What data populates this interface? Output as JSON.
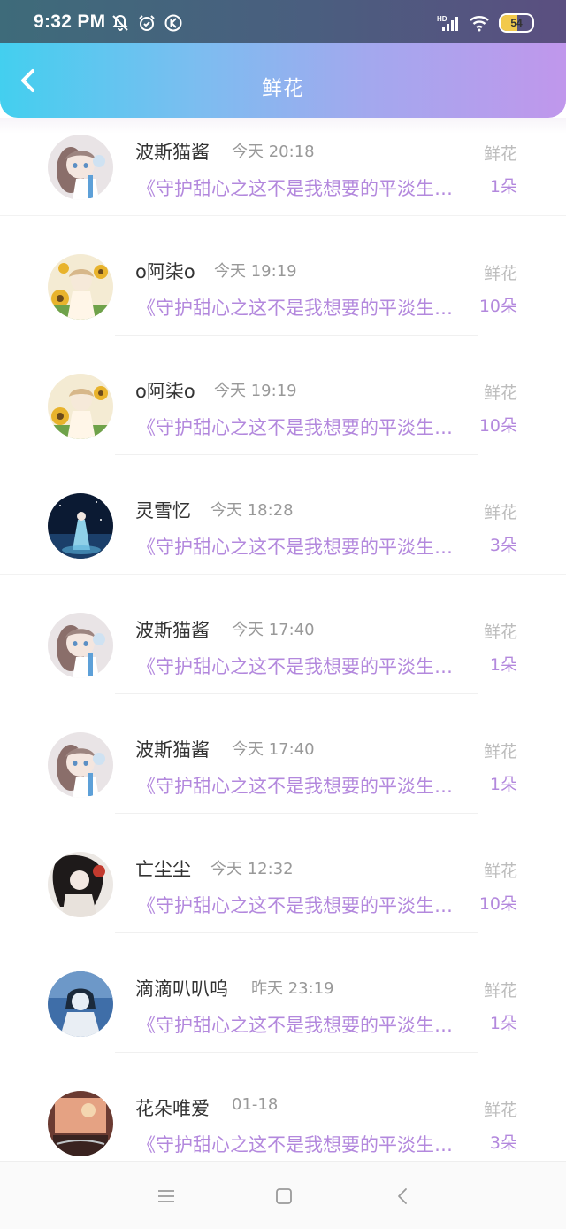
{
  "status_bar": {
    "time": "9:32 PM",
    "battery_level": "54",
    "icons": [
      "mute-icon",
      "alarm-icon",
      "k-icon",
      "hd-signal-icon",
      "wifi-icon",
      "battery-icon"
    ]
  },
  "header": {
    "title": "鲜花",
    "back_icon": "chevron-left-icon"
  },
  "colors": {
    "gradient_start": "#43cfef",
    "gradient_end": "#c097ec",
    "accent_purple": "#b388dd",
    "muted_gray": "#999999"
  },
  "items": [
    {
      "name": "波斯猫酱",
      "time": "今天 20:18",
      "book": "《守护甜心之这不是我想要的平淡生活》",
      "gift": "鲜花",
      "count": "1朵",
      "avatar": "avatar-catgirl"
    },
    {
      "name": "o阿柒o",
      "time": "今天 19:19",
      "book": "《守护甜心之这不是我想要的平淡生活》",
      "gift": "鲜花",
      "count": "10朵",
      "avatar": "avatar-sunflower"
    },
    {
      "name": "o阿柒o",
      "time": "今天 19:19",
      "book": "《守护甜心之这不是我想要的平淡生活》",
      "gift": "鲜花",
      "count": "10朵",
      "avatar": "avatar-sunflower"
    },
    {
      "name": "灵雪忆",
      "time": "今天 18:28",
      "book": "《守护甜心之这不是我想要的平淡生活》",
      "gift": "鲜花",
      "count": "3朵",
      "avatar": "avatar-night"
    },
    {
      "name": "波斯猫酱",
      "time": "今天 17:40",
      "book": "《守护甜心之这不是我想要的平淡生活》",
      "gift": "鲜花",
      "count": "1朵",
      "avatar": "avatar-catgirl"
    },
    {
      "name": "波斯猫酱",
      "time": "今天 17:40",
      "book": "《守护甜心之这不是我想要的平淡生活》",
      "gift": "鲜花",
      "count": "1朵",
      "avatar": "avatar-catgirl"
    },
    {
      "name": "亡尘尘",
      "time": "今天 12:32",
      "book": "《守护甜心之这不是我想要的平淡生活》",
      "gift": "鲜花",
      "count": "10朵",
      "avatar": "avatar-ancient"
    },
    {
      "name": "滴滴叭叭呜",
      "time": "昨天 23:19",
      "book": "《守护甜心之这不是我想要的平淡生活》",
      "gift": "鲜花",
      "count": "1朵",
      "avatar": "avatar-ocean"
    },
    {
      "name": "花朵唯爱",
      "time": "01-18",
      "book": "《守护甜心之这不是我想要的平淡生活》",
      "gift": "鲜花",
      "count": "3朵",
      "avatar": "avatar-sunset"
    }
  ],
  "nav": {
    "icons": [
      "menu-icon",
      "home-square-icon",
      "back-triangle-icon"
    ]
  }
}
